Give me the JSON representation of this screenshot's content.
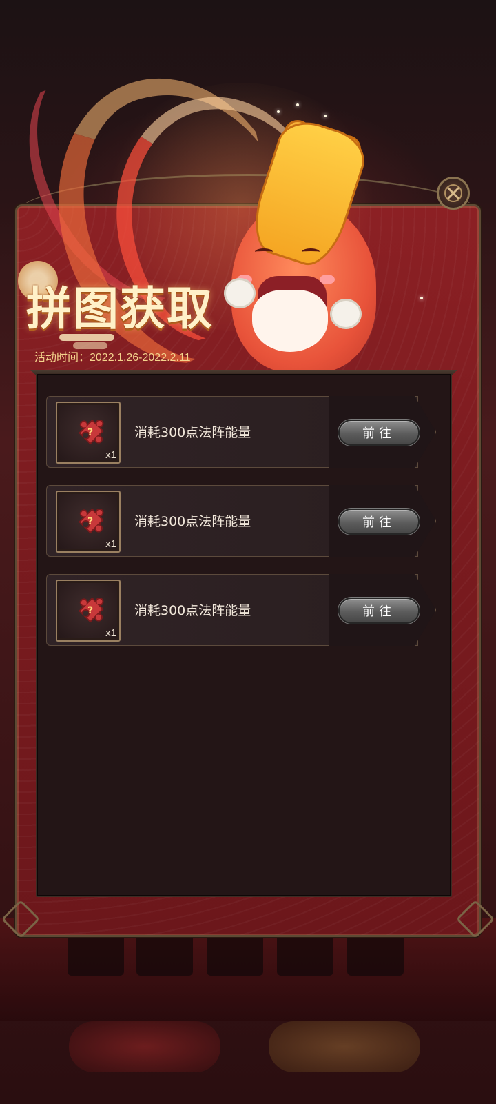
{
  "popup": {
    "title": "拼图获取",
    "event_time": "活动时间：2022.1.26-2022.2.11",
    "close_icon": "close-icon"
  },
  "tasks": [
    {
      "item_icon": "puzzle-piece-icon",
      "quantity": "x1",
      "description": "消耗300点法阵能量",
      "button_label": "前往"
    },
    {
      "item_icon": "puzzle-piece-icon",
      "quantity": "x1",
      "description": "消耗300点法阵能量",
      "button_label": "前往"
    },
    {
      "item_icon": "puzzle-piece-icon",
      "quantity": "x1",
      "description": "消耗300点法阵能量",
      "button_label": "前往"
    }
  ],
  "colors": {
    "panel_red": "#7a1b1f",
    "list_bg": "#231516",
    "title_gold": "#fff1c8",
    "time_gold": "#f4d38c",
    "button_gray": "#5c5c5c"
  }
}
